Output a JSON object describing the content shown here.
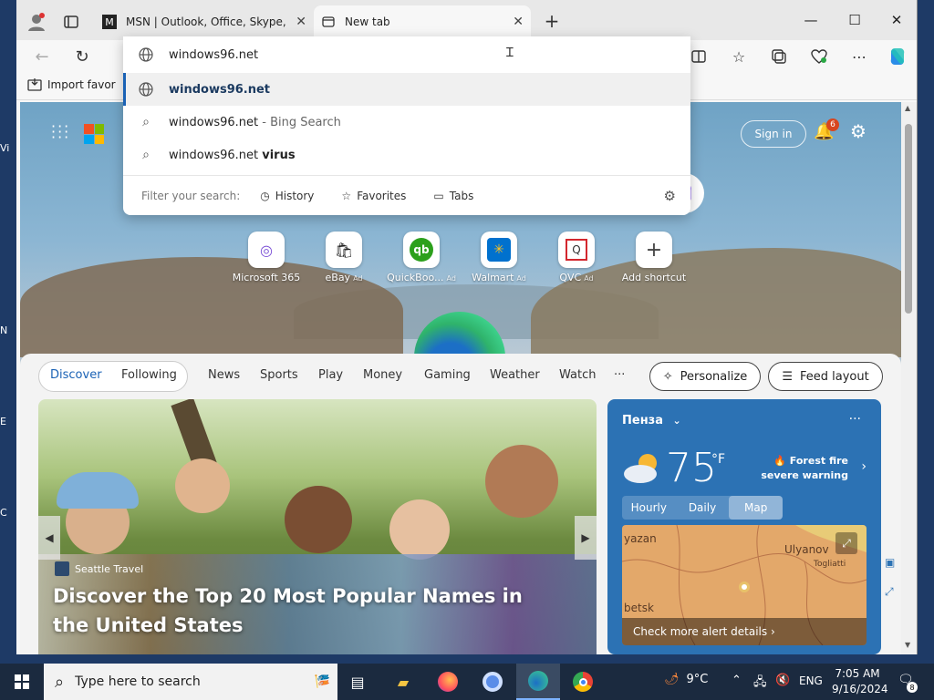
{
  "desktop": {
    "labels": [
      "Vi",
      "N",
      "E",
      "C"
    ]
  },
  "tabs": [
    {
      "title": "MSN | Outlook, Office, Skype, Bing",
      "active": false
    },
    {
      "title": "New tab",
      "active": true
    }
  ],
  "window_controls": {
    "minimize": "—",
    "maximize": "☐",
    "close": "✕"
  },
  "favorites_bar": {
    "import_label": "Import favor"
  },
  "omnibox": {
    "typed": "windows96.net",
    "suggestions": [
      {
        "icon": "globe-icon",
        "text": "windows96.net",
        "bold": "",
        "suffix": ""
      },
      {
        "icon": "search-icon",
        "text": "windows96.net",
        "bold": "",
        "suffix": " - Bing Search"
      },
      {
        "icon": "search-icon",
        "text": "windows96.net ",
        "bold": "virus",
        "suffix": ""
      }
    ],
    "filter_label": "Filter your search:",
    "filters": [
      "History",
      "Favorites",
      "Tabs"
    ]
  },
  "ntp": {
    "sign_in": "Sign in",
    "notification_count": "6",
    "shortcuts": [
      {
        "label": "Microsoft 365",
        "ad": "",
        "icon": "microsoft365-icon",
        "color": "#7b4fd6"
      },
      {
        "label": "eBay",
        "ad": "Ad",
        "icon": "ebay-icon",
        "color": "#1a1a1a"
      },
      {
        "label": "QuickBoo...",
        "ad": "Ad",
        "icon": "quickbooks-icon",
        "color": "#2ca01c"
      },
      {
        "label": "Walmart",
        "ad": "Ad",
        "icon": "walmart-icon",
        "color": "#0071ce"
      },
      {
        "label": "QVC",
        "ad": "Ad",
        "icon": "qvc-icon",
        "color": "#d3272e"
      },
      {
        "label": "Add shortcut",
        "ad": "",
        "icon": "plus-icon",
        "color": "#444"
      }
    ]
  },
  "feed": {
    "discover": "Discover",
    "following": "Following",
    "nav": [
      "News",
      "Sports",
      "Play",
      "Money",
      "Gaming",
      "Weather",
      "Watch"
    ],
    "more": "···",
    "personalize": "Personalize",
    "feed_layout": "Feed layout",
    "hero": {
      "source": "Seattle Travel",
      "title": "Discover the Top 20 Most Popular Names in the United States"
    }
  },
  "weather": {
    "city": "Пенза",
    "temp": "75",
    "unit": "°F",
    "alert_line1": "🔥 Forest fire",
    "alert_line2": "severe warning",
    "tabs": [
      "Hourly",
      "Daily",
      "Map"
    ],
    "map_labels": [
      "yazan",
      "Ulyanov",
      "Togliatti",
      "betsk"
    ],
    "alert_link": "Check more alert details ›"
  },
  "taskbar": {
    "search_placeholder": "Type here to search",
    "temp": "9°C",
    "lang": "ENG",
    "time": "7:05 AM",
    "date": "9/16/2024",
    "notif_count": "8"
  },
  "colors": {
    "accent": "#1a62b5",
    "taskbar": "#1b2a3f",
    "weather_card": "#2c72b4"
  }
}
